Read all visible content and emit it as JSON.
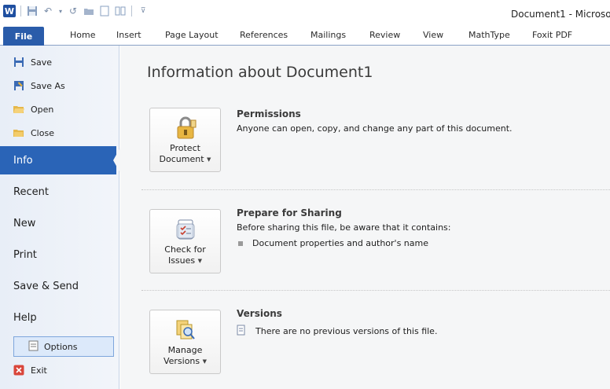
{
  "window": {
    "title": "Document1 - Microso"
  },
  "ribbon": {
    "tabs": [
      "File",
      "Home",
      "Insert",
      "Page Layout",
      "References",
      "Mailings",
      "Review",
      "View",
      "MathType",
      "Foxit PDF"
    ]
  },
  "nav": {
    "small_items": [
      "Save",
      "Save As",
      "Open",
      "Close"
    ],
    "big_items": [
      "Info",
      "Recent",
      "New",
      "Print",
      "Save & Send",
      "Help"
    ],
    "options": "Options",
    "exit": "Exit"
  },
  "main": {
    "title": "Information about Document1",
    "permissions": {
      "button_line1": "Protect",
      "button_line2": "Document",
      "heading": "Permissions",
      "description": "Anyone can open, copy, and change any part of this document."
    },
    "sharing": {
      "button_line1": "Check for",
      "button_line2": "Issues",
      "heading": "Prepare for Sharing",
      "description": "Before sharing this file, be aware that it contains:",
      "bullet": "Document properties and author's name"
    },
    "versions": {
      "button_line1": "Manage",
      "button_line2": "Versions",
      "heading": "Versions",
      "description": "There are no previous versions of this file."
    }
  },
  "colors": {
    "accent": "#2a64b7",
    "file_tab": "#2a5caa"
  }
}
